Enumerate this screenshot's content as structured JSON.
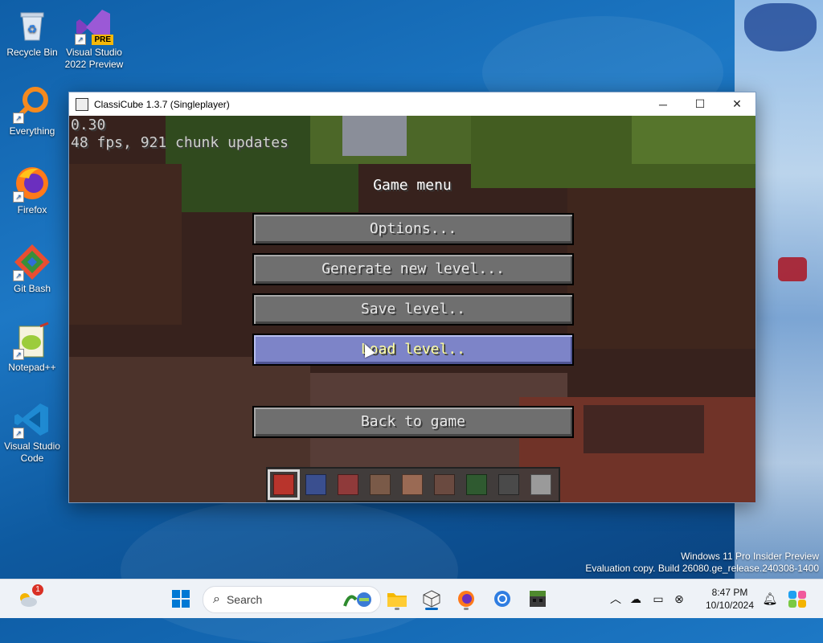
{
  "desktop": {
    "icons": [
      {
        "label": "Recycle Bin",
        "icon": "recycle-bin-icon"
      },
      {
        "label": "Visual Studio 2022 Preview",
        "badge": "PRE",
        "icon": "visual-studio-icon"
      },
      {
        "label": "Everything",
        "icon": "everything-search-icon"
      },
      {
        "label": "Firefox",
        "icon": "firefox-icon"
      },
      {
        "label": "Git Bash",
        "icon": "git-bash-icon"
      },
      {
        "label": "Notepad++",
        "icon": "notepad-plus-plus-icon"
      },
      {
        "label": "Visual Studio Code",
        "icon": "vscode-icon"
      }
    ]
  },
  "window": {
    "title": "ClassiCube 1.3.7 (Singleplayer)",
    "controls": {
      "minimize": "─",
      "maximize": "☐",
      "close": "✕"
    }
  },
  "game": {
    "hud": {
      "line1": "0.30",
      "line2": "48 fps, 921 chunk updates"
    },
    "menu_title": "Game menu",
    "buttons": {
      "options": "Options...",
      "generate": "Generate new level...",
      "save": "Save level..",
      "load": "Load level..",
      "back": "Back to game"
    },
    "hovered_button": "load",
    "hotbar": {
      "selected_slot": 1,
      "blocks": [
        "tnt",
        "lapis",
        "red-ore",
        "dirt",
        "clay",
        "dirt-dark",
        "leaves",
        "cobweb",
        "stone"
      ]
    }
  },
  "watermark": {
    "line1": "Windows 11 Pro Insider Preview",
    "line2": "Evaluation copy. Build 26080.ge_release.240308-1400"
  },
  "taskbar": {
    "weather_badge": "1",
    "search_placeholder": "Search",
    "clock_time": "8:47 PM",
    "clock_date": "10/10/2024"
  },
  "colors": {
    "accent": "#0067c0",
    "mc_button": "#6f6f6f",
    "mc_button_hover": "#7d84c8",
    "mc_hover_text": "#ffffa0"
  }
}
